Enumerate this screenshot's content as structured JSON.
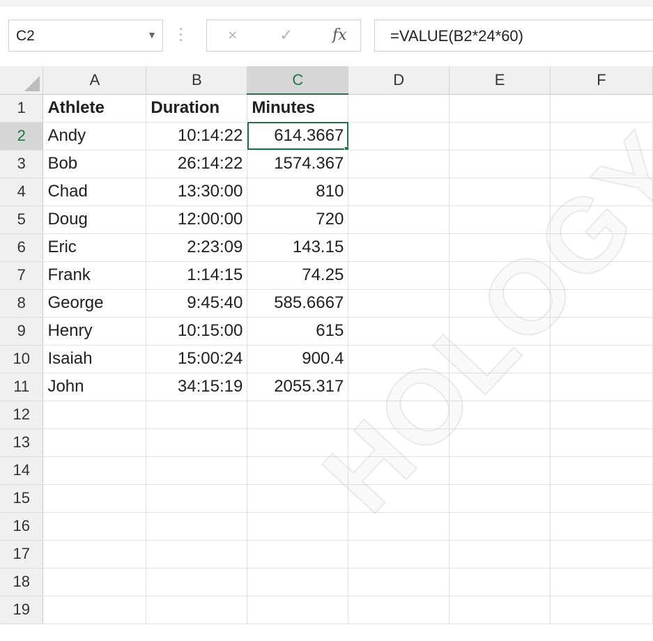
{
  "namebox": {
    "value": "C2",
    "arrow_icon": "dropdown-arrow-icon"
  },
  "formula_bar": {
    "cancel_icon": "×",
    "enter_icon": "✓",
    "fx_label": "fx",
    "formula": "=VALUE(B2*24*60)"
  },
  "columns": [
    "A",
    "B",
    "C",
    "D",
    "E",
    "F"
  ],
  "rows": [
    {
      "num": "1",
      "a": "Athlete",
      "b": "Duration",
      "c": "Minutes"
    },
    {
      "num": "2",
      "a": "Andy",
      "b": "10:14:22",
      "c": "614.3667"
    },
    {
      "num": "3",
      "a": "Bob",
      "b": "26:14:22",
      "c": "1574.367"
    },
    {
      "num": "4",
      "a": "Chad",
      "b": "13:30:00",
      "c": "810"
    },
    {
      "num": "5",
      "a": "Doug",
      "b": "12:00:00",
      "c": "720"
    },
    {
      "num": "6",
      "a": "Eric",
      "b": "2:23:09",
      "c": "143.15"
    },
    {
      "num": "7",
      "a": "Frank",
      "b": "1:14:15",
      "c": "74.25"
    },
    {
      "num": "8",
      "a": "George",
      "b": "9:45:40",
      "c": "585.6667"
    },
    {
      "num": "9",
      "a": "Henry",
      "b": "10:15:00",
      "c": "615"
    },
    {
      "num": "10",
      "a": "Isaiah",
      "b": "15:00:24",
      "c": "900.4"
    },
    {
      "num": "11",
      "a": "John",
      "b": "34:15:19",
      "c": "2055.317"
    },
    {
      "num": "12",
      "a": "",
      "b": "",
      "c": ""
    },
    {
      "num": "13",
      "a": "",
      "b": "",
      "c": ""
    },
    {
      "num": "14",
      "a": "",
      "b": "",
      "c": ""
    },
    {
      "num": "15",
      "a": "",
      "b": "",
      "c": ""
    },
    {
      "num": "16",
      "a": "",
      "b": "",
      "c": ""
    },
    {
      "num": "17",
      "a": "",
      "b": "",
      "c": ""
    },
    {
      "num": "18",
      "a": "",
      "b": "",
      "c": ""
    },
    {
      "num": "19",
      "a": "",
      "b": "",
      "c": ""
    }
  ],
  "watermark": "HOLOGY",
  "colors": {
    "accent": "#217346",
    "header_bg": "#f0f0f0",
    "selected_header_bg": "#d6d6d6"
  }
}
